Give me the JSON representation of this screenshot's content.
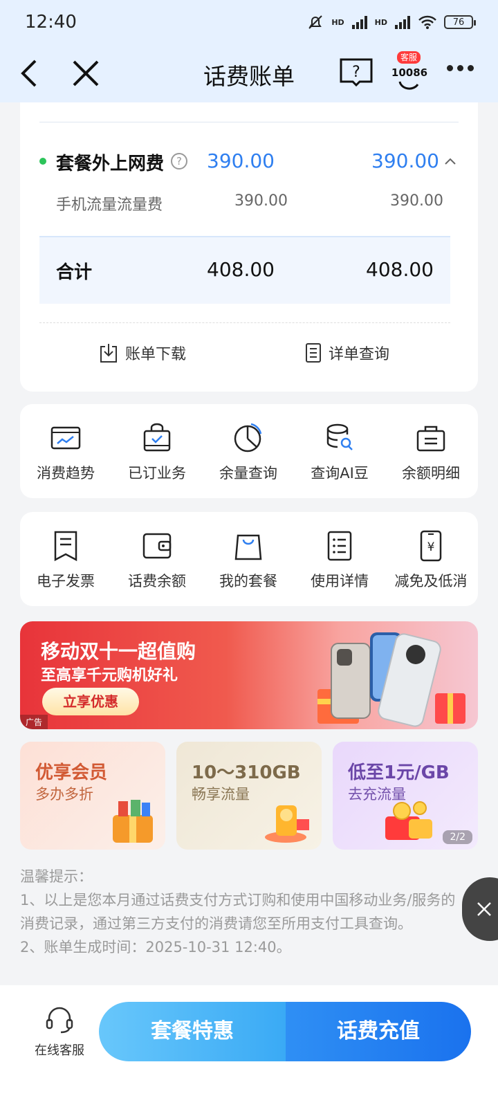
{
  "status": {
    "time": "12:40",
    "battery": "76",
    "net1": "HD",
    "net2": "HD"
  },
  "nav": {
    "title": "话费账单",
    "cs_badge": "客服",
    "cs_number": "10086"
  },
  "bill": {
    "item_label": "套餐外上网费",
    "item_value1": "390.00",
    "item_value2": "390.00",
    "sub_label": "手机流量流量费",
    "sub_value1": "390.00",
    "sub_value2": "390.00",
    "total_label": "合计",
    "total_value1": "408.00",
    "total_value2": "408.00",
    "download": "账单下载",
    "detail": "详单查询"
  },
  "grid1": [
    {
      "label": "消费趋势",
      "icon": "trend-icon"
    },
    {
      "label": "已订业务",
      "icon": "subscribed-bag-icon"
    },
    {
      "label": "余量查询",
      "icon": "pie-chart-icon"
    },
    {
      "label": "查询AI豆",
      "icon": "coins-search-icon"
    },
    {
      "label": "余额明细",
      "icon": "balance-bag-icon"
    }
  ],
  "grid2": [
    {
      "label": "电子发票",
      "icon": "invoice-icon"
    },
    {
      "label": "话费余额",
      "icon": "wallet-icon"
    },
    {
      "label": "我的套餐",
      "icon": "shopping-bag-icon"
    },
    {
      "label": "使用详情",
      "icon": "list-icon"
    },
    {
      "label": "减免及低消",
      "icon": "phone-yuan-icon"
    }
  ],
  "banner": {
    "title": "移动双十一超值购",
    "subtitle": "至高享千元购机好礼",
    "button": "立享优惠",
    "ad": "广告"
  },
  "promos": [
    {
      "title": "优享会员",
      "subtitle": "多办多折"
    },
    {
      "title": "10～310GB",
      "subtitle": "畅享流量"
    },
    {
      "title": "低至1元/GB",
      "subtitle": "去充流量",
      "pager": "2/2"
    }
  ],
  "tips": {
    "heading": "温馨提示：",
    "line1": "1、以上是您本月通过话费支付方式订购和使用中国移动业务/服务的消费记录，通过第三方支付的消费请您至所用支付工具查询。",
    "line2": "2、账单生成时间：2025-10-31 12:40。"
  },
  "bottom": {
    "cs": "在线客服",
    "btn_a": "套餐特惠",
    "btn_b": "话费充值"
  },
  "colors": {
    "accent": "#2f7ff0",
    "header_bg": "#e6f1ff",
    "green_dot": "#2cc45a"
  }
}
